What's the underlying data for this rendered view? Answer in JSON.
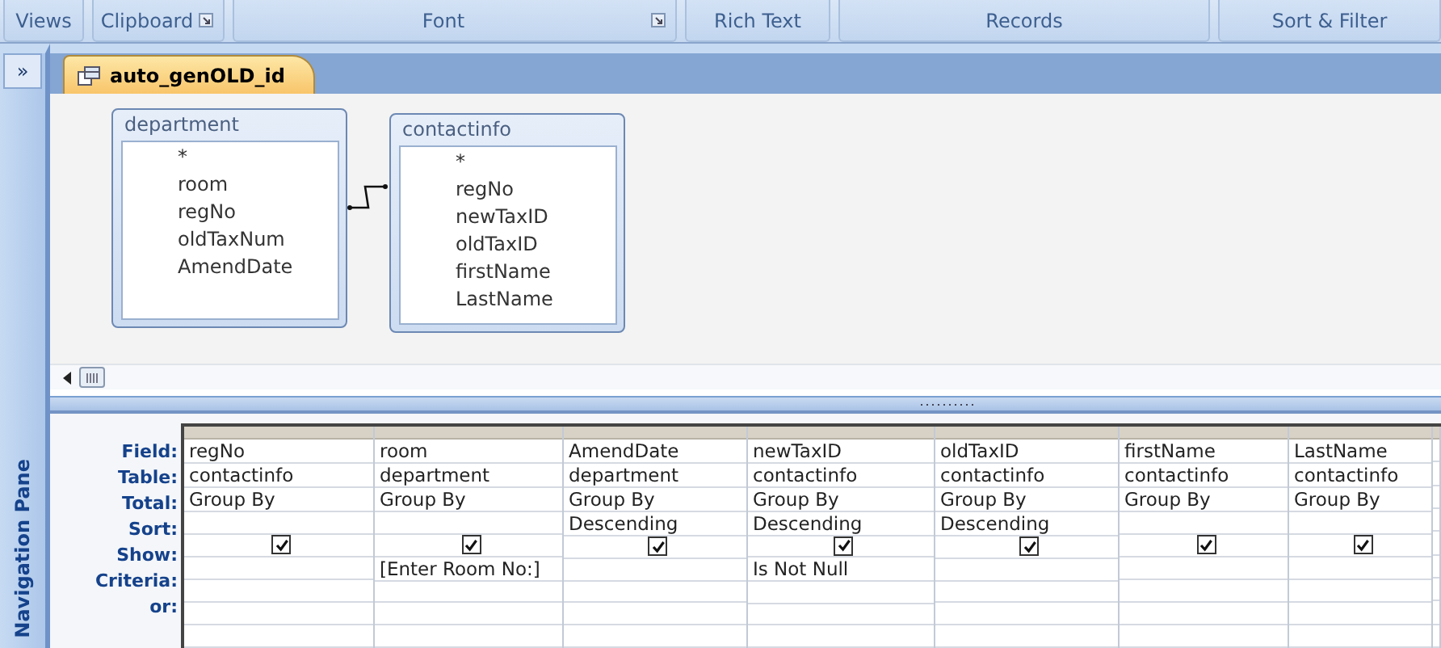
{
  "ribbon_groups": [
    {
      "label": "Views",
      "launcher": false
    },
    {
      "label": "Clipboard",
      "launcher": true
    },
    {
      "label": "Font",
      "launcher": true
    },
    {
      "label": "Rich Text",
      "launcher": false
    },
    {
      "label": "Records",
      "launcher": false
    },
    {
      "label": "Sort & Filter",
      "launcher": false
    }
  ],
  "nav_toggle": "»",
  "nav_pane": "Navigation Pane",
  "tabs": [
    {
      "label": "auto_genOLD_id",
      "selected": true
    }
  ],
  "tables": [
    {
      "name": "department",
      "fields": [
        "*",
        "room",
        "regNo",
        "oldTaxNum",
        "AmendDate"
      ]
    },
    {
      "name": "contactinfo",
      "fields": [
        "*",
        "regNo",
        "newTaxID",
        "oldTaxID",
        "firstName",
        "LastName"
      ]
    }
  ],
  "grid": {
    "row_labels": [
      "Field:",
      "Table:",
      "Total:",
      "Sort:",
      "Show:",
      "Criteria:",
      "or:"
    ],
    "columns": [
      {
        "field": "regNo",
        "table": "contactinfo",
        "total": "Group By",
        "show": true
      },
      {
        "field": "room",
        "table": "department",
        "total": "Group By",
        "show": true,
        "criteria": "[Enter Room No:]"
      },
      {
        "field": "AmendDate",
        "table": "department",
        "total": "Group By",
        "sort": "Descending",
        "show": true
      },
      {
        "field": "newTaxID",
        "table": "contactinfo",
        "total": "Group By",
        "sort": "Descending",
        "show": true,
        "criteria": "Is Not Null"
      },
      {
        "field": "oldTaxID",
        "table": "contactinfo",
        "total": "Group By",
        "sort": "Descending",
        "show": true
      },
      {
        "field": "firstName",
        "table": "contactinfo",
        "total": "Group By",
        "show": true
      },
      {
        "field": "LastName",
        "table": "contactinfo",
        "total": "Group By",
        "show": true
      }
    ]
  }
}
